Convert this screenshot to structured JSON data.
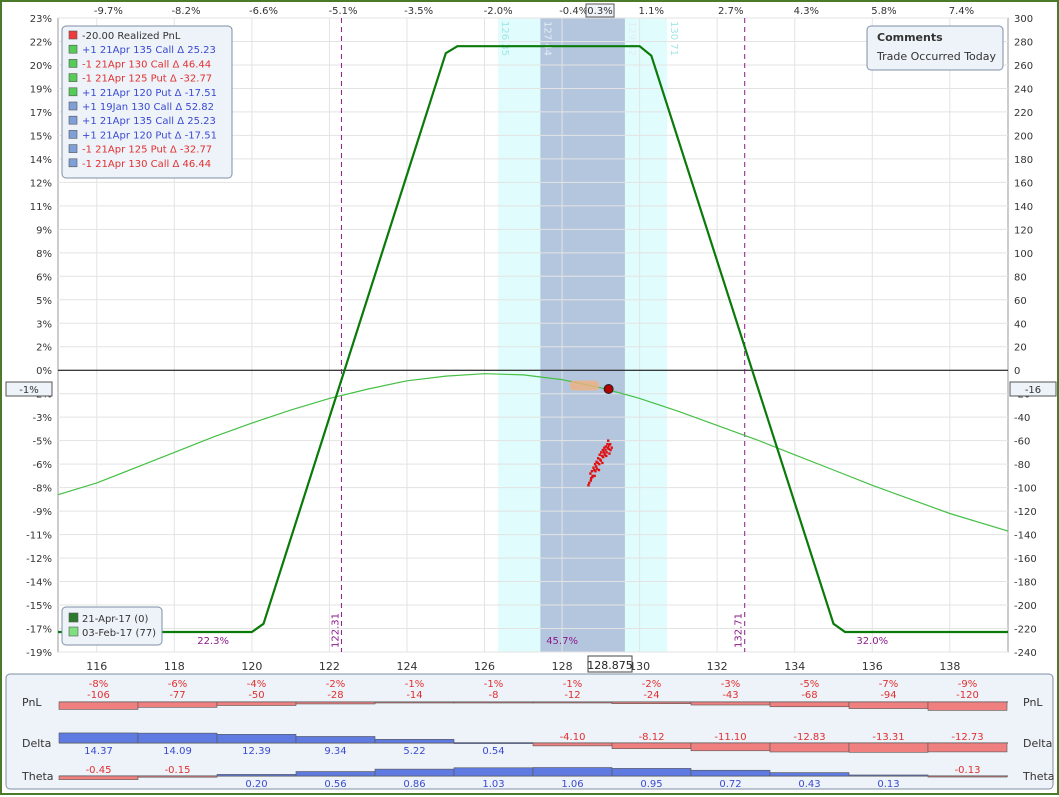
{
  "chart_data": {
    "type": "line",
    "price_axis": {
      "min": 115,
      "max": 139.5,
      "ticks": [
        116,
        118,
        120,
        122,
        124,
        126,
        128,
        130,
        132,
        134,
        136,
        138
      ]
    },
    "left_axis": {
      "min": -19,
      "max": 23,
      "ticks": [
        "23%",
        "22%",
        "20%",
        "19%",
        "17%",
        "15%",
        "14%",
        "12%",
        "11%",
        "9%",
        "8%",
        "6%",
        "5%",
        "3%",
        "2%",
        "0%",
        "-2%",
        "-3%",
        "-5%",
        "-6%",
        "-8%",
        "-9%",
        "-11%",
        "-12%",
        "-14%",
        "-15%",
        "-17%",
        "-19%"
      ],
      "unit": "%"
    },
    "right_axis": {
      "min": -240,
      "max": 300,
      "ticks": [
        300,
        280,
        260,
        240,
        220,
        200,
        180,
        160,
        140,
        120,
        100,
        80,
        60,
        40,
        20,
        0,
        -20,
        -40,
        -60,
        -80,
        -100,
        -120,
        -140,
        -160,
        -180,
        -200,
        -220,
        -240
      ]
    },
    "top_axis_ticks": [
      {
        "price": 116.3,
        "label": "-9.7%"
      },
      {
        "price": 118.3,
        "label": "-8.2%"
      },
      {
        "price": 120.3,
        "label": "-6.6%"
      },
      {
        "price": 122.35,
        "label": "-5.1%"
      },
      {
        "price": 124.3,
        "label": "-3.5%"
      },
      {
        "price": 126.35,
        "label": "-2.0%"
      },
      {
        "price": 128.3,
        "label": "-0.4%"
      },
      {
        "price": 130.3,
        "label": "1.1%"
      },
      {
        "price": 132.35,
        "label": "2.7%"
      },
      {
        "price": 134.3,
        "label": "4.3%"
      },
      {
        "price": 136.3,
        "label": "5.8%"
      },
      {
        "price": 138.3,
        "label": "7.4%"
      }
    ],
    "top_current_label": "0.3%",
    "current_price": 128.875,
    "current_price_label": "128.875",
    "left_marker_label": "-1%",
    "right_marker_label": "-16",
    "expiry_series": {
      "name": "21-Apr-17 (0)",
      "color": "#0a7a0a",
      "points": [
        [
          115,
          -223
        ],
        [
          120,
          -223
        ],
        [
          120.3,
          -216
        ],
        [
          125,
          270
        ],
        [
          125.3,
          276
        ],
        [
          130,
          276
        ],
        [
          130.3,
          268
        ],
        [
          135,
          -216
        ],
        [
          135.3,
          -223
        ],
        [
          139.5,
          -223
        ]
      ]
    },
    "today_series": {
      "name": "03-Feb-17 (77)",
      "color": "#44c044",
      "points": [
        [
          115,
          -106
        ],
        [
          116,
          -96
        ],
        [
          117,
          -83
        ],
        [
          118,
          -70
        ],
        [
          119,
          -57
        ],
        [
          120,
          -45
        ],
        [
          121,
          -34
        ],
        [
          122,
          -24
        ],
        [
          123,
          -16
        ],
        [
          124,
          -9
        ],
        [
          125,
          -5
        ],
        [
          126,
          -3
        ],
        [
          127,
          -4
        ],
        [
          128,
          -8
        ],
        [
          129,
          -15
        ],
        [
          130,
          -24
        ],
        [
          131,
          -35
        ],
        [
          132,
          -47
        ],
        [
          133,
          -59
        ],
        [
          134,
          -72
        ],
        [
          135,
          -85
        ],
        [
          136,
          -98
        ],
        [
          137,
          -110
        ],
        [
          138,
          -122
        ],
        [
          139.5,
          -137
        ]
      ]
    },
    "breakevens": [
      {
        "price": 122.31,
        "label": "122.31"
      },
      {
        "price": 132.71,
        "label": "132.71"
      }
    ],
    "bands": [
      {
        "lo": 126.35,
        "hi": 130.71,
        "lo_label": "126.35",
        "hi_label": "130.71",
        "color": "#e0fcfc"
      },
      {
        "lo": 127.44,
        "hi": 129.62,
        "lo_label": "127.44",
        "hi_label": "129.62",
        "color": "#b4c6de"
      }
    ],
    "prob_labels": [
      {
        "price": 119,
        "label": "22.3%"
      },
      {
        "price": 128,
        "label": "45.7%"
      },
      {
        "price": 136,
        "label": "32.0%"
      }
    ],
    "history_points": [
      [
        128.73,
        -88
      ],
      [
        128.77,
        -86
      ],
      [
        128.81,
        -83
      ],
      [
        128.85,
        -80
      ],
      [
        128.89,
        -78
      ],
      [
        128.93,
        -75
      ],
      [
        128.97,
        -72
      ],
      [
        129.01,
        -70
      ],
      [
        129.05,
        -68
      ],
      [
        129.09,
        -66
      ],
      [
        129.13,
        -65
      ],
      [
        129.17,
        -63
      ],
      [
        128.75,
        -92
      ],
      [
        128.79,
        -90
      ],
      [
        128.83,
        -85
      ],
      [
        128.88,
        -82
      ],
      [
        128.92,
        -79
      ],
      [
        128.98,
        -76
      ],
      [
        129.03,
        -73
      ],
      [
        129.08,
        -70
      ],
      [
        129.12,
        -68
      ],
      [
        129.18,
        -66
      ],
      [
        129.21,
        -64
      ],
      [
        128.7,
        -96
      ],
      [
        128.74,
        -94
      ],
      [
        128.78,
        -91
      ],
      [
        128.86,
        -86
      ],
      [
        128.9,
        -84
      ],
      [
        128.96,
        -80
      ],
      [
        129.0,
        -77
      ],
      [
        129.06,
        -74
      ],
      [
        129.1,
        -72
      ],
      [
        129.15,
        -70
      ],
      [
        129.2,
        -67
      ],
      [
        129.24,
        -63
      ],
      [
        128.68,
        -98
      ],
      [
        128.95,
        -85
      ],
      [
        129.04,
        -79
      ],
      [
        129.14,
        -73
      ],
      [
        129.25,
        -68
      ],
      [
        128.84,
        -90
      ],
      [
        129.22,
        -71
      ],
      [
        129.19,
        -60
      ],
      [
        129.28,
        -66
      ]
    ],
    "position_point": {
      "price": 129.2,
      "value": -16
    },
    "cost_marker": {
      "lo": 128.2,
      "hi": 128.95,
      "value": -13
    },
    "legend": [
      {
        "label": "-20.00 Realized PnL",
        "color": "#ee3b3b",
        "text_color": "#333333"
      },
      {
        "label": "+1 21Apr 135 Call Δ    25.23",
        "color": "#55cc55",
        "text_color": "#3a4ad0"
      },
      {
        "label": "-1 21Apr 130 Call Δ    46.44",
        "color": "#55cc55",
        "text_color": "#e03030"
      },
      {
        "label": "-1 21Apr 125 Put Δ  -32.77",
        "color": "#55cc55",
        "text_color": "#e03030"
      },
      {
        "label": "+1 21Apr 120 Put Δ   -17.51",
        "color": "#55cc55",
        "text_color": "#3a4ad0"
      },
      {
        "label": "+1 19Jan 130 Call Δ    52.82",
        "color": "#7f9fd8",
        "text_color": "#3a4ad0"
      },
      {
        "label": "+1 21Apr 135 Call Δ    25.23",
        "color": "#7f9fd8",
        "text_color": "#3a4ad0"
      },
      {
        "label": "+1 21Apr 120 Put Δ   -17.51",
        "color": "#7f9fd8",
        "text_color": "#3a4ad0"
      },
      {
        "label": "-1 21Apr 125 Put Δ  -32.77",
        "color": "#7f9fd8",
        "text_color": "#e03030"
      },
      {
        "label": "-1 21Apr 130 Call Δ    46.44",
        "color": "#7f9fd8",
        "text_color": "#e03030"
      }
    ],
    "date_legend": [
      {
        "label": "21-Apr-17 (0)",
        "color": "#2d7a2d"
      },
      {
        "label": "03-Feb-17 (77)",
        "color": "#7fe07f"
      }
    ],
    "comments": {
      "title": "Comments",
      "text": "Trade Occurred Today"
    },
    "greeks": {
      "pnl": {
        "label": "PnL",
        "pct": [
          "-8%",
          "-6%",
          "-4%",
          "-2%",
          "-1%",
          "-1%",
          "-1%",
          "-2%",
          "-3%",
          "-5%",
          "-7%",
          "-9%"
        ],
        "values": [
          -106,
          -77,
          -50,
          -28,
          -14,
          -8,
          -12,
          -24,
          -43,
          -68,
          -94,
          -120
        ]
      },
      "delta": {
        "label": "Delta",
        "values": [
          14.37,
          14.09,
          12.39,
          9.34,
          5.22,
          0.54,
          -4.1,
          -8.12,
          -11.1,
          -12.83,
          -13.31,
          -12.73
        ],
        "labels": [
          "14.37",
          "14.09",
          "12.39",
          "9.34",
          "5.22",
          "0.54",
          "-4.10",
          "-8.12",
          "-11.10",
          "-12.83",
          "-13.31",
          "-12.73"
        ]
      },
      "theta": {
        "label": "Theta",
        "values": [
          -0.45,
          -0.15,
          0.2,
          0.56,
          0.86,
          1.03,
          1.06,
          0.95,
          0.72,
          0.43,
          0.13,
          -0.13
        ],
        "labels": [
          "-0.45",
          "-0.15",
          "0.20",
          "0.56",
          "0.86",
          "1.03",
          "1.06",
          "0.95",
          "0.72",
          "0.43",
          "0.13",
          "-0.13"
        ]
      }
    }
  }
}
